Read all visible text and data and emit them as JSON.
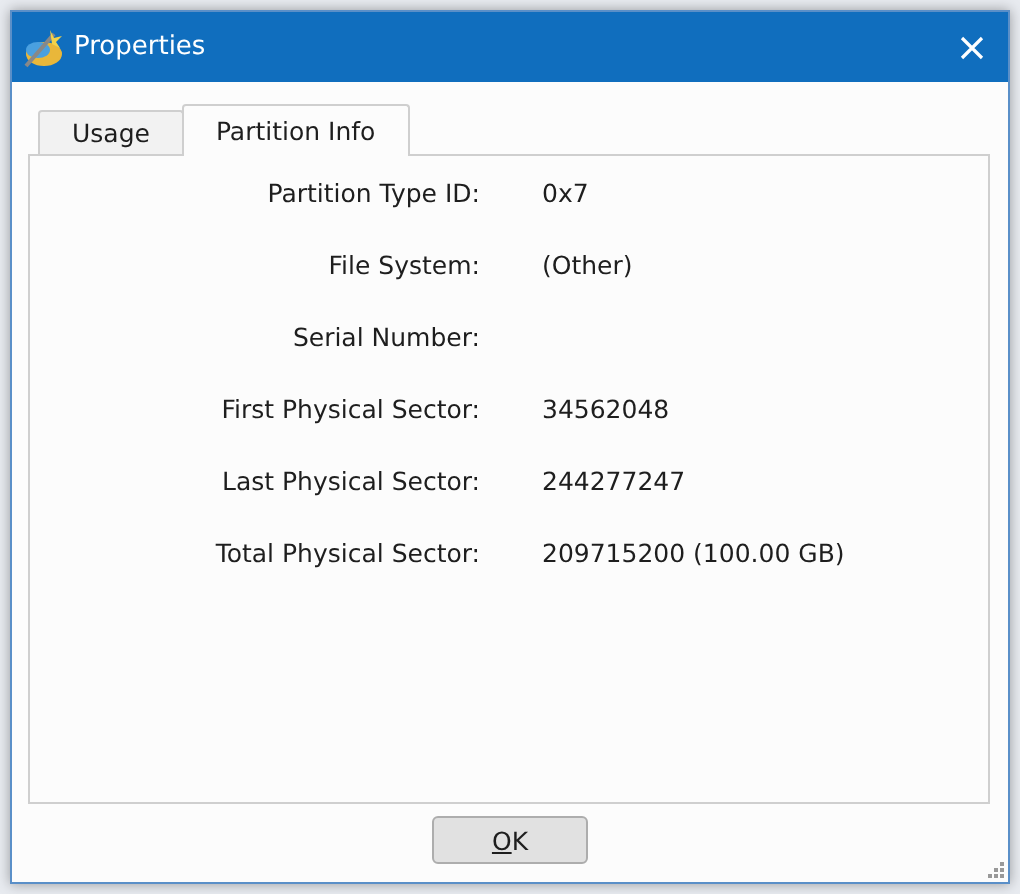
{
  "window": {
    "title": "Properties"
  },
  "tabs": [
    {
      "label": "Usage",
      "selected": false
    },
    {
      "label": "Partition Info",
      "selected": true
    }
  ],
  "fields": [
    {
      "label": "Partition Type ID:",
      "value": "0x7"
    },
    {
      "label": "File System:",
      "value": "(Other)"
    },
    {
      "label": "Serial Number:"
    },
    {
      "label": "First Physical Sector:",
      "value": "34562048"
    },
    {
      "label": "Last Physical Sector:",
      "value": "244277247"
    },
    {
      "label": "Total Physical Sector:",
      "value": "209715200 (100.00 GB)"
    }
  ],
  "buttons": [
    {
      "label": "OK",
      "mnemonic_underlined": true
    }
  ]
}
